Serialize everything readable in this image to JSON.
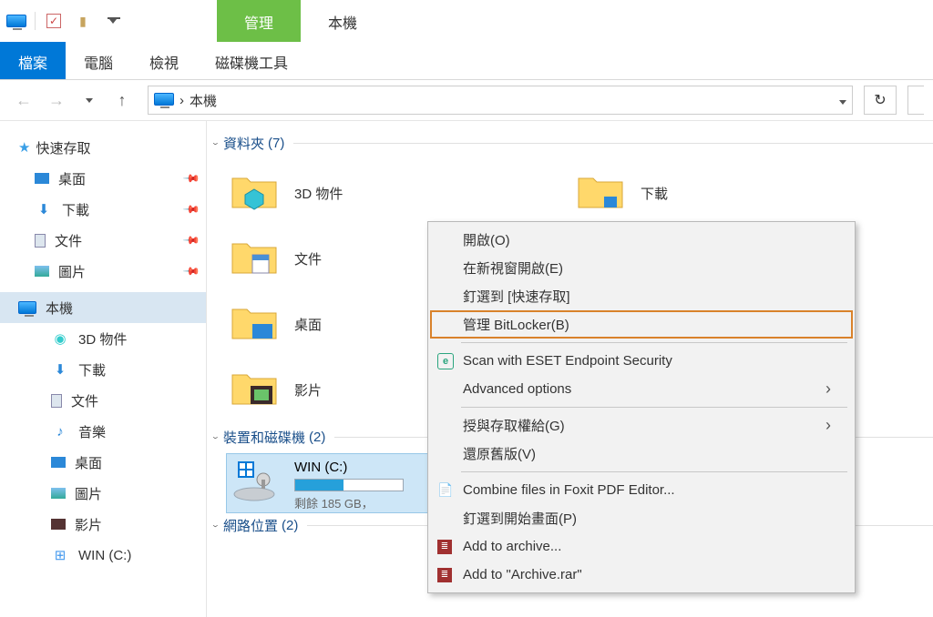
{
  "title_tabs": {
    "manage": "管理",
    "pc": "本機"
  },
  "ribbon": {
    "file": "檔案",
    "computer": "電腦",
    "view": "檢視",
    "drivetools": "磁碟機工具"
  },
  "breadcrumb": {
    "location": "本機",
    "sep": "›"
  },
  "sidebar": {
    "quickaccess": "快速存取",
    "desktop": "桌面",
    "downloads": "下載",
    "documents": "文件",
    "pictures": "圖片",
    "thispc": "本機",
    "obj3d": "3D 物件",
    "downloads2": "下載",
    "documents2": "文件",
    "music": "音樂",
    "desktop2": "桌面",
    "pictures2": "圖片",
    "videos": "影片",
    "drive_c": "WIN (C:)"
  },
  "groups": {
    "folders_label": "資料夾",
    "folders_count": "(7)",
    "drives_label": "裝置和磁碟機",
    "drives_count": "(2)",
    "network_label": "網路位置",
    "network_count": "(2)"
  },
  "folders": {
    "obj3d": "3D 物件",
    "downloads": "下載",
    "documents": "文件",
    "desktop": "桌面",
    "videos": "影片"
  },
  "drive": {
    "name": "WIN (C:)",
    "free": "剩餘 185 GB，"
  },
  "context_menu": {
    "open": "開啟(O)",
    "open_new": "在新視窗開啟(E)",
    "pin_quick": "釘選到 [快速存取]",
    "bitlocker": "管理 BitLocker(B)",
    "eset": "Scan with ESET Endpoint Security",
    "advanced": "Advanced options",
    "grant": "授與存取權給(G)",
    "restore": "還原舊版(V)",
    "foxit": "Combine files in Foxit PDF Editor...",
    "pin_start": "釘選到開始畫面(P)",
    "add_archive": "Add to archive...",
    "add_rar": "Add to \"Archive.rar\""
  }
}
